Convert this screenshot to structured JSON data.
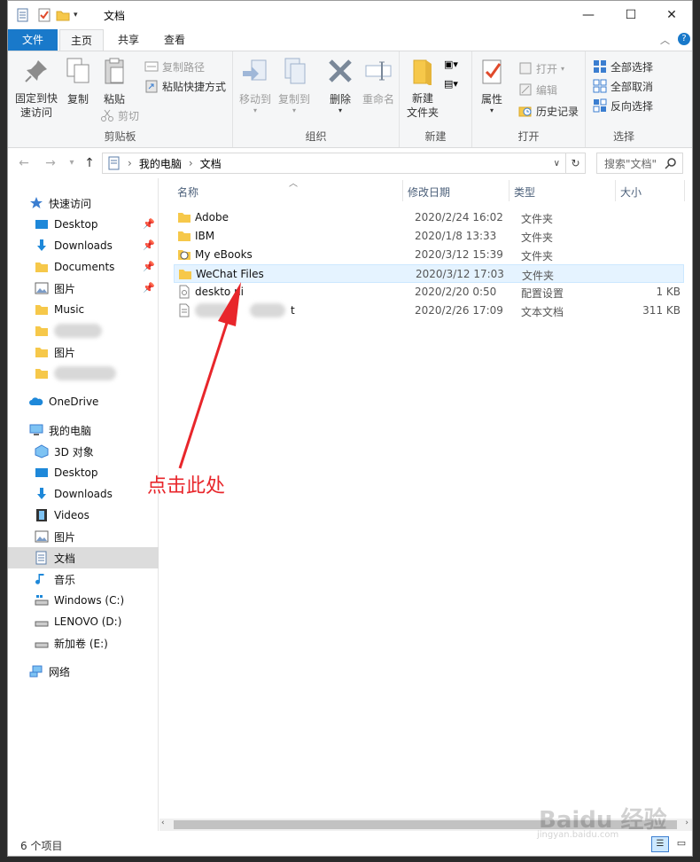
{
  "window": {
    "title": "文档"
  },
  "ribbon_tabs": [
    "文件",
    "主页",
    "共享",
    "查看"
  ],
  "clipboard": {
    "pin": "固定到快速访问",
    "copy": "复制",
    "paste": "粘贴",
    "copy_path": "复制路径",
    "paste_shortcut": "粘贴快捷方式",
    "cut": "剪切",
    "label": "剪贴板"
  },
  "organize": {
    "move_to": "移动到",
    "copy_to": "复制到",
    "delete": "删除",
    "rename": "重命名",
    "label": "组织"
  },
  "new": {
    "new_folder": "新建\n文件夹",
    "label": "新建"
  },
  "open": {
    "properties": "属性",
    "open": "打开",
    "edit": "编辑",
    "history": "历史记录",
    "label": "打开"
  },
  "select": {
    "select_all": "全部选择",
    "select_none": "全部取消",
    "invert": "反向选择",
    "label": "选择"
  },
  "address": {
    "crumbs": [
      "我的电脑",
      "文档"
    ],
    "search_placeholder": "搜索\"文档\""
  },
  "nav": {
    "quick_access": "快速访问",
    "quick": [
      "Desktop",
      "Downloads",
      "Documents",
      "图片",
      "Music",
      "",
      "图片",
      ""
    ],
    "onedrive": "OneDrive",
    "this_pc": "我的电脑",
    "pc": [
      "3D 对象",
      "Desktop",
      "Downloads",
      "Videos",
      "图片",
      "文档",
      "音乐",
      "Windows (C:)",
      "LENOVO (D:)",
      "新加卷 (E:)"
    ],
    "network": "网络"
  },
  "columns": {
    "name": "名称",
    "date": "修改日期",
    "type": "类型",
    "size": "大小"
  },
  "files": [
    {
      "name": "Adobe",
      "date": "2020/2/24 16:02",
      "type": "文件夹",
      "size": ""
    },
    {
      "name": "IBM",
      "date": "2020/1/8 13:33",
      "type": "文件夹",
      "size": ""
    },
    {
      "name": "My eBooks",
      "date": "2020/3/12 15:39",
      "type": "文件夹",
      "size": ""
    },
    {
      "name": "WeChat Files",
      "date": "2020/3/12 17:03",
      "type": "文件夹",
      "size": ""
    },
    {
      "name": "deskto  ni",
      "date": "2020/2/20 0:50",
      "type": "配置设置",
      "size": "1 KB"
    },
    {
      "name": "t",
      "date": "2020/2/26 17:09",
      "type": "文本文档",
      "size": "311 KB"
    }
  ],
  "status": {
    "count": "6 个项目"
  },
  "annotation": "点击此处",
  "watermark": {
    "main": "Baidu 经验",
    "sub": "jingyan.baidu.com"
  },
  "colors": {
    "file_tab": "#1979ca",
    "folder": "#f6c84a",
    "annotation": "#e8262b",
    "selection": "#e5f3ff"
  }
}
